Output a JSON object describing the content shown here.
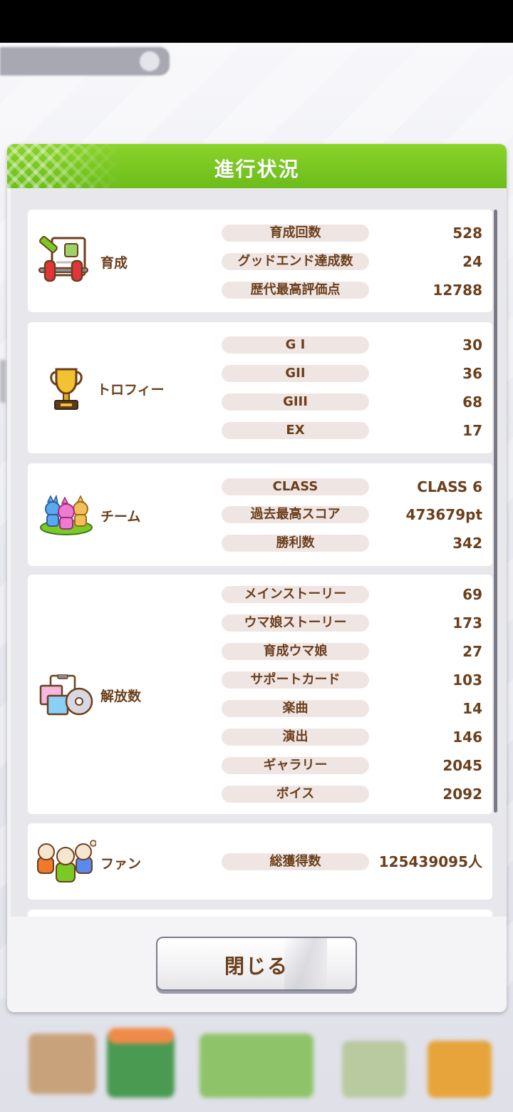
{
  "dialog": {
    "title": "進行状況",
    "close_label": "閉じる"
  },
  "sections": {
    "training": {
      "label": "育成",
      "icon": "training-icon",
      "rows": [
        {
          "label": "育成回数",
          "value": "528"
        },
        {
          "label": "グッドエンド達成数",
          "value": "24"
        },
        {
          "label": "歴代最高評価点",
          "value": "12788"
        }
      ]
    },
    "trophy": {
      "label": "トロフィー",
      "icon": "trophy-icon",
      "rows": [
        {
          "label": "G I",
          "value": "30"
        },
        {
          "label": "GII",
          "value": "36"
        },
        {
          "label": "GIII",
          "value": "68"
        },
        {
          "label": "EX",
          "value": "17"
        }
      ]
    },
    "team": {
      "label": "チーム",
      "icon": "team-icon",
      "rows": [
        {
          "label": "CLASS",
          "value": "CLASS 6"
        },
        {
          "label": "過去最高スコア",
          "value": "473679pt"
        },
        {
          "label": "勝利数",
          "value": "342"
        }
      ]
    },
    "unlocks": {
      "label": "解放数",
      "icon": "unlock-icon",
      "rows": [
        {
          "label": "メインストーリー",
          "value": "69"
        },
        {
          "label": "ウマ娘ストーリー",
          "value": "173"
        },
        {
          "label": "育成ウマ娘",
          "value": "27"
        },
        {
          "label": "サポートカード",
          "value": "103"
        },
        {
          "label": "楽曲",
          "value": "14"
        },
        {
          "label": "演出",
          "value": "146"
        },
        {
          "label": "ギャラリー",
          "value": "2045"
        },
        {
          "label": "ボイス",
          "value": "2092"
        }
      ]
    },
    "fans": {
      "label": "ファン",
      "icon": "fans-icon",
      "rows": [
        {
          "label": "総獲得数",
          "value": "125439095人"
        }
      ]
    }
  },
  "colors": {
    "header_green": "#7ac925",
    "text_brown": "#6b3f1c",
    "pill_bg": "#efe5e3"
  }
}
